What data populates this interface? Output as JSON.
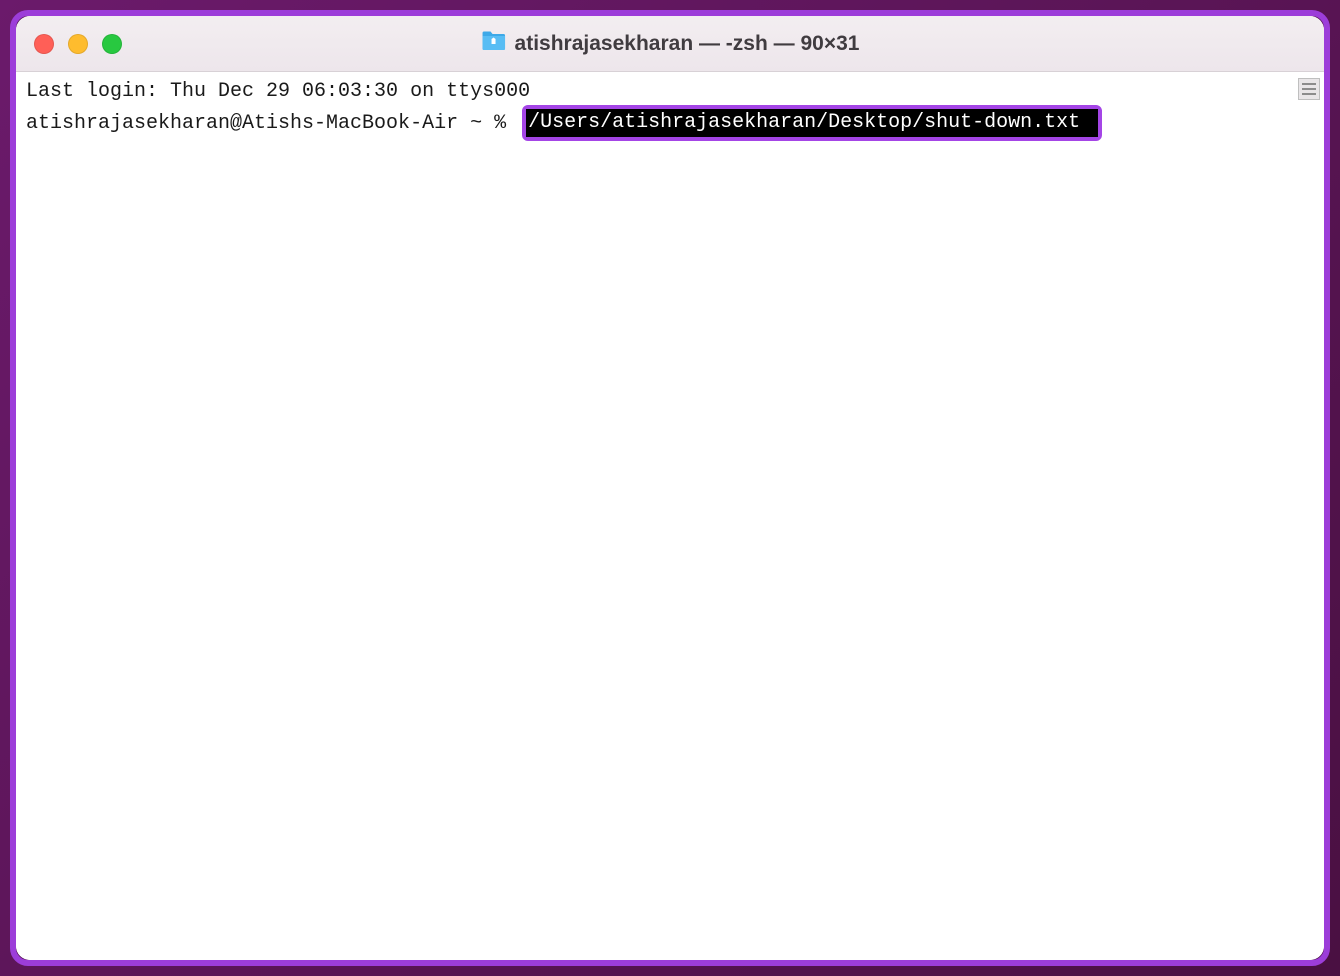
{
  "window": {
    "title": "atishrajasekharan — -zsh — 90×31"
  },
  "terminal": {
    "last_login": "Last login: Thu Dec 29 06:03:30 on ttys000",
    "prompt": "atishrajasekharan@Atishs-MacBook-Air ~ % ",
    "highlighted_path": "/Users/atishrajasekharan/Desktop/shut-down.txt "
  }
}
